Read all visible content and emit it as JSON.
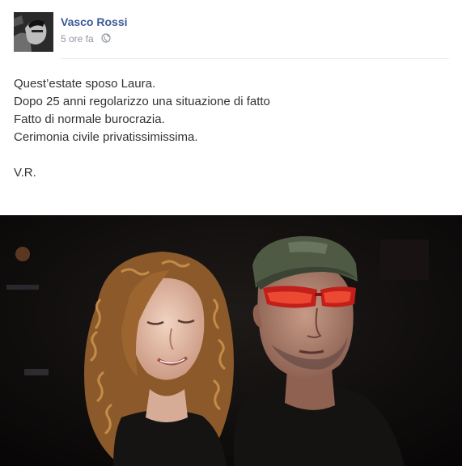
{
  "post": {
    "author": "Vasco Rossi",
    "timestamp": "5 ore fa",
    "audience_icon": "globe-icon",
    "message_lines": [
      "Quest’estate sposo Laura.",
      "Dopo 25 anni regolarizzo una situazione di fatto",
      "Fatto di normale burocrazia.",
      "Cerimonia civile privatissimissima."
    ],
    "signature": "V.R."
  },
  "colors": {
    "author_link": "#3b5998",
    "meta_text": "#9197a3",
    "body_text": "#333333"
  }
}
